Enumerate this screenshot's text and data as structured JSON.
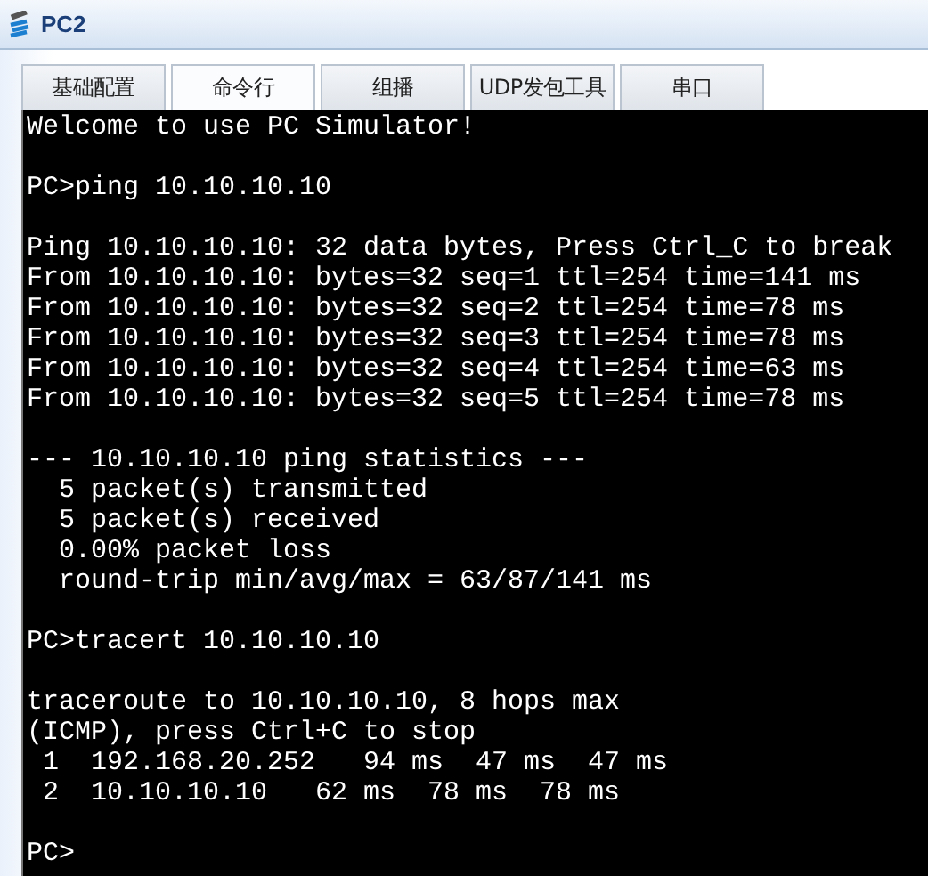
{
  "window": {
    "title": "PC2"
  },
  "tabs": [
    {
      "label": "基础配置",
      "selected": false
    },
    {
      "label": "命令行",
      "selected": true
    },
    {
      "label": "组播",
      "selected": false
    },
    {
      "label": "UDP发包工具",
      "selected": false
    },
    {
      "label": "串口",
      "selected": false
    }
  ],
  "console": {
    "blocks": [
      [
        "Welcome to use PC Simulator!"
      ],
      [
        "PC>ping 10.10.10.10"
      ],
      [
        "Ping 10.10.10.10: 32 data bytes, Press Ctrl_C to break",
        "From 10.10.10.10: bytes=32 seq=1 ttl=254 time=141 ms",
        "From 10.10.10.10: bytes=32 seq=2 ttl=254 time=78 ms",
        "From 10.10.10.10: bytes=32 seq=3 ttl=254 time=78 ms",
        "From 10.10.10.10: bytes=32 seq=4 ttl=254 time=63 ms",
        "From 10.10.10.10: bytes=32 seq=5 ttl=254 time=78 ms"
      ],
      [
        "--- 10.10.10.10 ping statistics ---",
        "  5 packet(s) transmitted",
        "  5 packet(s) received",
        "  0.00% packet loss",
        "  round-trip min/avg/max = 63/87/141 ms"
      ],
      [
        "PC>tracert 10.10.10.10"
      ],
      [
        "traceroute to 10.10.10.10, 8 hops max",
        "(ICMP), press Ctrl+C to stop",
        " 1  192.168.20.252   94 ms  47 ms  47 ms",
        " 2  10.10.10.10   62 ms  78 ms  78 ms"
      ],
      [
        "PC>"
      ]
    ]
  }
}
